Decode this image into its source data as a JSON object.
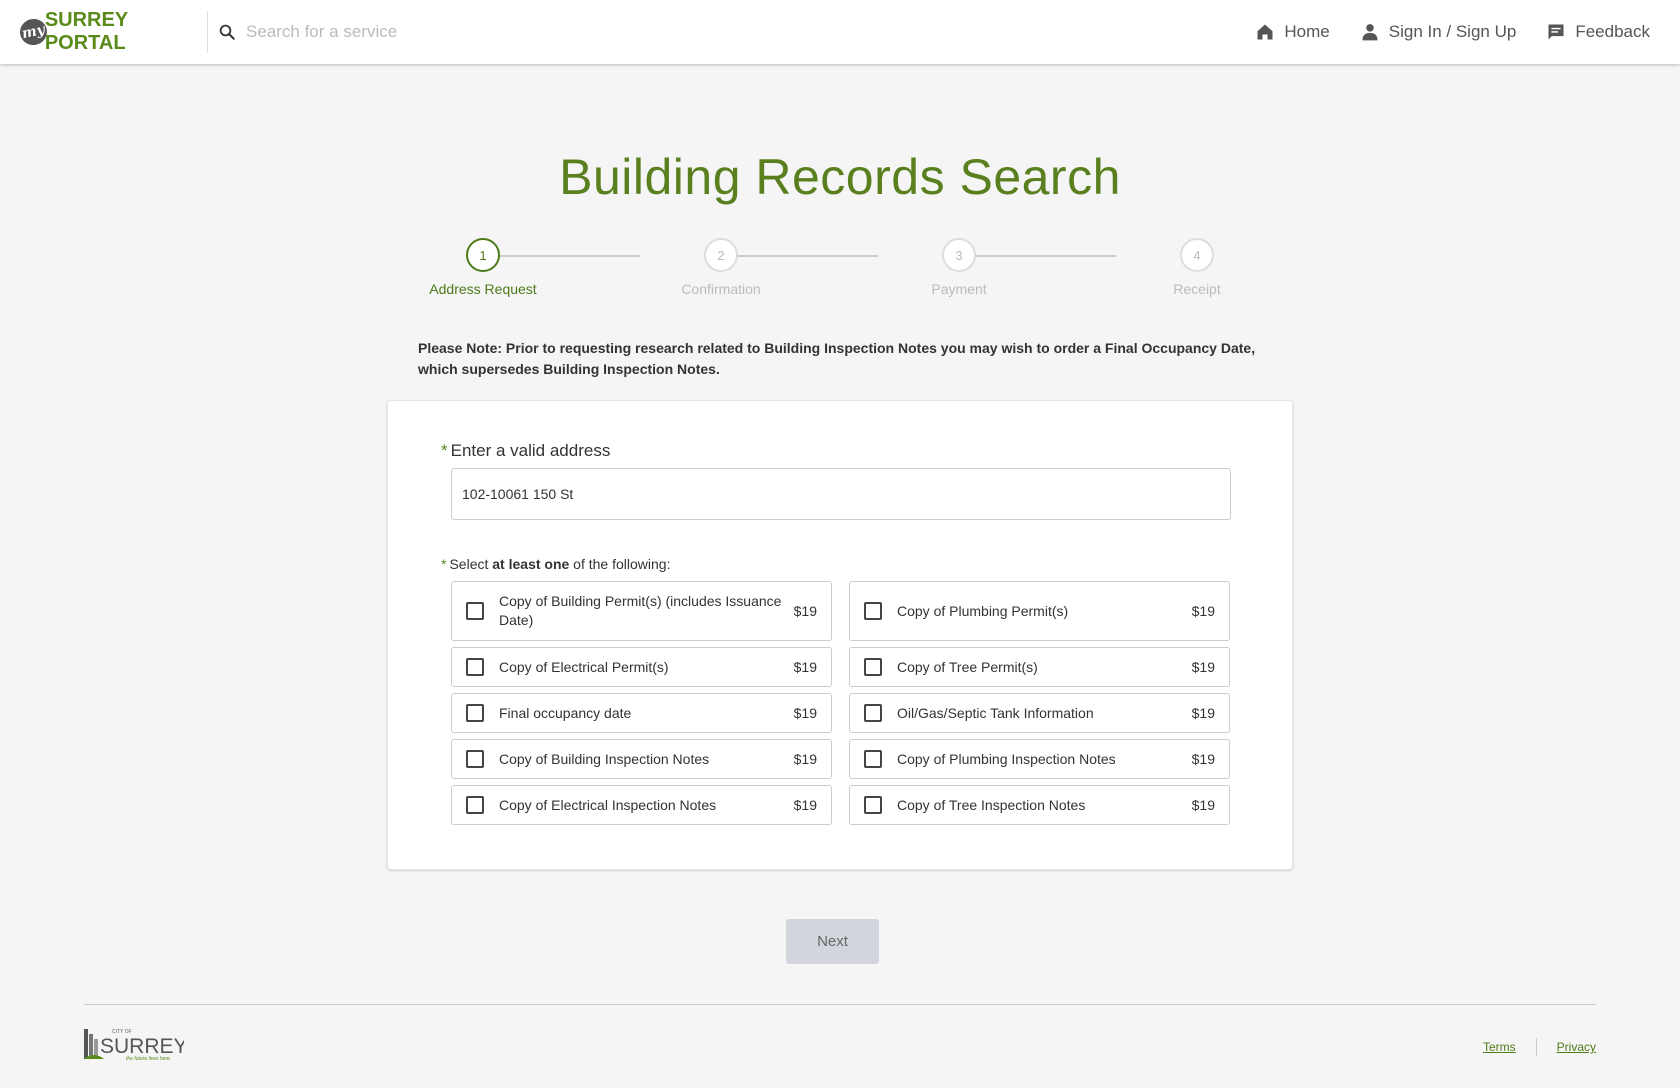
{
  "header": {
    "logo_my": "my",
    "logo_text": "SURREY PORTAL",
    "search_placeholder": "Search for a service",
    "nav": {
      "home": "Home",
      "sign_in": "Sign In / Sign Up",
      "feedback": "Feedback"
    }
  },
  "page": {
    "title": "Building Records Search"
  },
  "stepper": {
    "steps": [
      {
        "number": "1",
        "label": "Address Request",
        "active": true
      },
      {
        "number": "2",
        "label": "Confirmation",
        "active": false
      },
      {
        "number": "3",
        "label": "Payment",
        "active": false
      },
      {
        "number": "4",
        "label": "Receipt",
        "active": false
      }
    ]
  },
  "note": "Please Note: Prior to requesting research related to Building Inspection Notes you may wish to order a Final Occupancy Date, which supersedes Building Inspection Notes.",
  "form": {
    "required_mark": "*",
    "address_label": "Enter a valid address",
    "address_value": "102-10061 150 St",
    "select_prefix": "Select ",
    "select_bold": "at least one",
    "select_suffix": " of the following:",
    "options": [
      {
        "label": "Copy of Building Permit(s) (includes Issuance Date)",
        "price": "$19",
        "checked": false
      },
      {
        "label": "Copy of Plumbing Permit(s)",
        "price": "$19",
        "checked": false
      },
      {
        "label": "Copy of Electrical Permit(s)",
        "price": "$19",
        "checked": false
      },
      {
        "label": "Copy of Tree Permit(s)",
        "price": "$19",
        "checked": false
      },
      {
        "label": "Final occupancy date",
        "price": "$19",
        "checked": false
      },
      {
        "label": "Oil/Gas/Septic Tank Information",
        "price": "$19",
        "checked": false
      },
      {
        "label": "Copy of Building Inspection Notes",
        "price": "$19",
        "checked": false
      },
      {
        "label": "Copy of Plumbing Inspection Notes",
        "price": "$19",
        "checked": false
      },
      {
        "label": "Copy of Electrical Inspection Notes",
        "price": "$19",
        "checked": false
      },
      {
        "label": "Copy of Tree Inspection Notes",
        "price": "$19",
        "checked": false
      }
    ],
    "next_label": "Next"
  },
  "footer": {
    "logo_city": "CITY OF",
    "logo_surrey": "SURREY",
    "logo_tagline": "the future lives here.",
    "links": {
      "terms": "Terms",
      "privacy": "Privacy"
    }
  },
  "colors": {
    "brand_green": "#5a7f1e",
    "background": "#f5f5f5",
    "button_disabled": "#d2d6dc"
  }
}
